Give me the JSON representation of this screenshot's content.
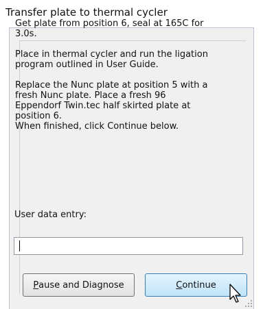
{
  "window": {
    "title": "Transfer plate to thermal cycler"
  },
  "instructions": {
    "paragraphs": [
      "Get plate from position 6, seal at 165C for\n3.0s.",
      "Place in thermal cycler and run the ligation\nprogram outlined in User Guide.",
      "Replace the Nunc plate at position 5 with a\nfresh Nunc plate.  Place a fresh 96\nEppendorf Twin.tec half skirted plate at\nposition 6.\nWhen finished, click Continue below."
    ]
  },
  "entry": {
    "label": "User data entry:",
    "value": "",
    "placeholder": ""
  },
  "buttons": {
    "pause": {
      "mnemonic": "P",
      "rest": "ause and Diagnose"
    },
    "continue": {
      "mnemonic": "C",
      "rest": "ontinue"
    }
  },
  "icons": {
    "cursor": "mouse-pointer-icon",
    "grip": "resize-grip-icon"
  },
  "colors": {
    "client_bg": "#f0f0f0",
    "continue_bg": "#bfe4f9",
    "continue_border": "#3c7fb1",
    "pause_border": "#707070"
  }
}
